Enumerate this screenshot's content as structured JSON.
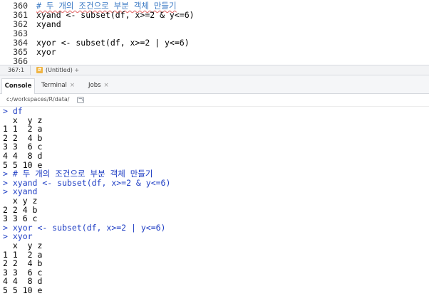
{
  "editor": {
    "lines": [
      {
        "num": "360",
        "text": "# 두 개의 조건으로 부분 객체 만들기",
        "comment": true
      },
      {
        "num": "361",
        "text": "xyand <- subset(df, x>=2 & y<=6)",
        "comment": false
      },
      {
        "num": "362",
        "text": "xyand",
        "comment": false
      },
      {
        "num": "363",
        "text": "",
        "comment": false
      },
      {
        "num": "364",
        "text": "xyor <- subset(df, x>=2 | y<=6)",
        "comment": false
      },
      {
        "num": "365",
        "text": "xyor",
        "comment": false
      },
      {
        "num": "366",
        "text": "",
        "comment": false
      }
    ]
  },
  "status": {
    "position": "367:1",
    "scope": "(Untitled) ÷"
  },
  "tabs": {
    "console": "Console",
    "terminal": "Terminal",
    "jobs": "Jobs",
    "close_glyph": "×"
  },
  "path": "c:/workspaces/R/data/",
  "console": {
    "lines": [
      {
        "text": "> df",
        "kind": "in"
      },
      {
        "text": "  x  y z",
        "kind": "out"
      },
      {
        "text": "1 1  2 a",
        "kind": "out"
      },
      {
        "text": "2 2  4 b",
        "kind": "out"
      },
      {
        "text": "3 3  6 c",
        "kind": "out"
      },
      {
        "text": "4 4  8 d",
        "kind": "out"
      },
      {
        "text": "5 5 10 e",
        "kind": "out"
      },
      {
        "text": "> # 두 개의 조건으로 부분 객체 만들기",
        "kind": "in"
      },
      {
        "text": "> xyand <- subset(df, x>=2 & y<=6)",
        "kind": "in"
      },
      {
        "text": "> xyand",
        "kind": "in"
      },
      {
        "text": "  x y z",
        "kind": "out"
      },
      {
        "text": "2 2 4 b",
        "kind": "out"
      },
      {
        "text": "3 3 6 c",
        "kind": "out"
      },
      {
        "text": "> xyor <- subset(df, x>=2 | y<=6)",
        "kind": "in"
      },
      {
        "text": "> xyor",
        "kind": "in"
      },
      {
        "text": "  x  y z",
        "kind": "out"
      },
      {
        "text": "1 1  2 a",
        "kind": "out"
      },
      {
        "text": "2 2  4 b",
        "kind": "out"
      },
      {
        "text": "3 3  6 c",
        "kind": "out"
      },
      {
        "text": "4 4  8 d",
        "kind": "out"
      },
      {
        "text": "5 5 10 e",
        "kind": "out"
      }
    ]
  }
}
